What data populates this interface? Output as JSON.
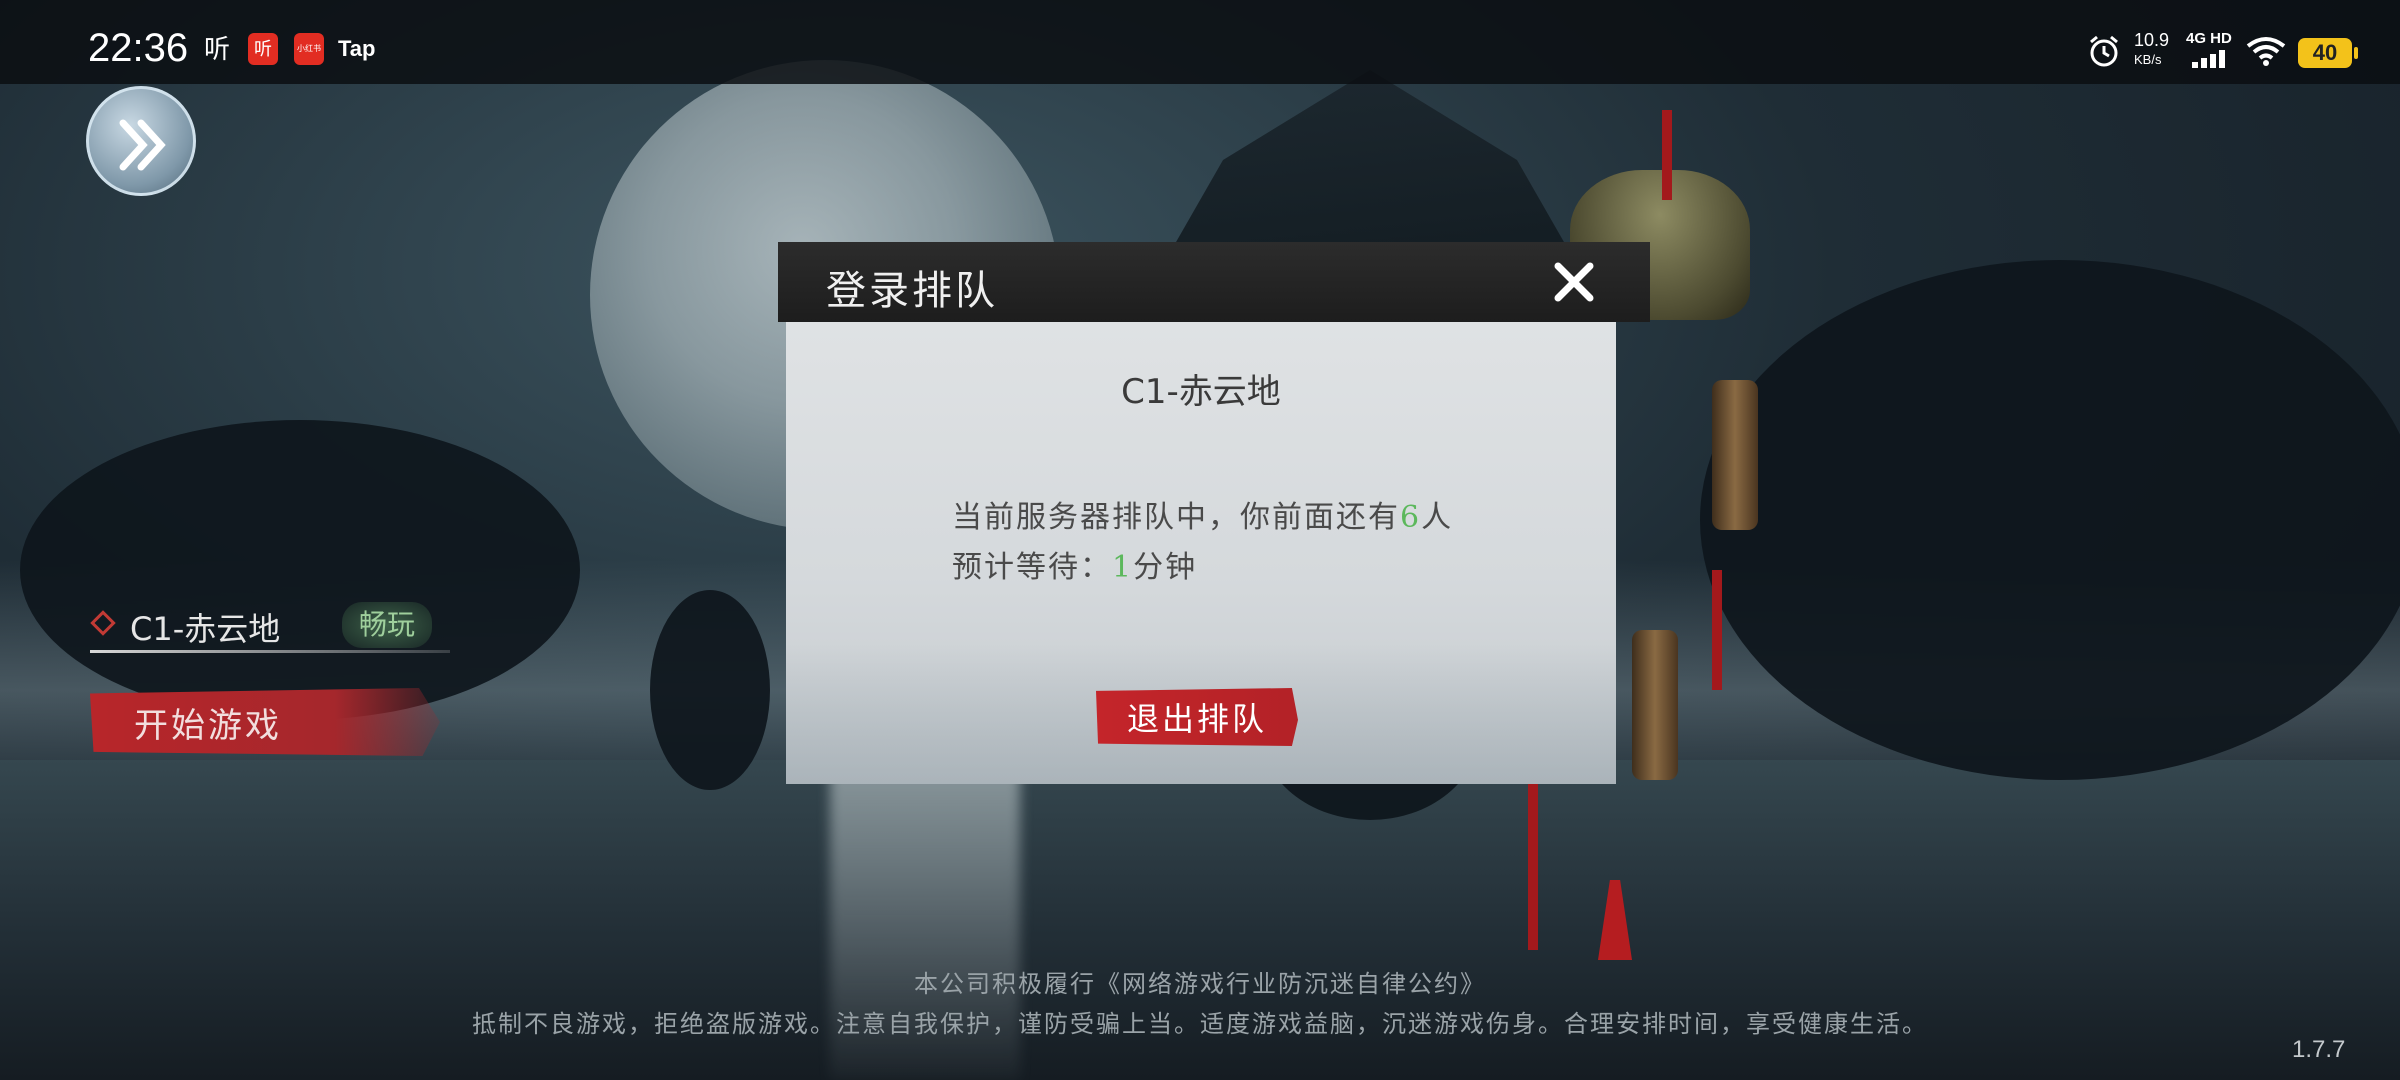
{
  "status_bar": {
    "time": "22:36",
    "app_icons": [
      "听",
      "听",
      "小红书",
      "Tap"
    ],
    "net_speed": "10.9",
    "net_unit": "KB/s",
    "network": "4G HD",
    "battery": "40"
  },
  "left_panel": {
    "server_name": "C1-赤云地",
    "server_status": "畅玩",
    "start_button": "开始游戏"
  },
  "dialog": {
    "title": "登录排队",
    "server": "C1-赤云地",
    "queue_prefix": "当前服务器排队中，你前面还有",
    "queue_count": "6",
    "queue_suffix": "人",
    "wait_prefix": "预计等待：",
    "wait_minutes": "1",
    "wait_suffix": "分钟",
    "quit_button": "退出排队"
  },
  "footer": {
    "line1": "本公司积极履行《网络游戏行业防沉迷自律公约》",
    "line2": "抵制不良游戏，拒绝盗版游戏。注意自我保护，谨防受骗上当。适度游戏益脑，沉迷游戏伤身。合理安排时间，享受健康生活。"
  },
  "version": "1.7.7",
  "colors": {
    "accent_red": "#b8262a",
    "highlight_green": "#5cb85c",
    "battery_yellow": "#f3c21a"
  }
}
